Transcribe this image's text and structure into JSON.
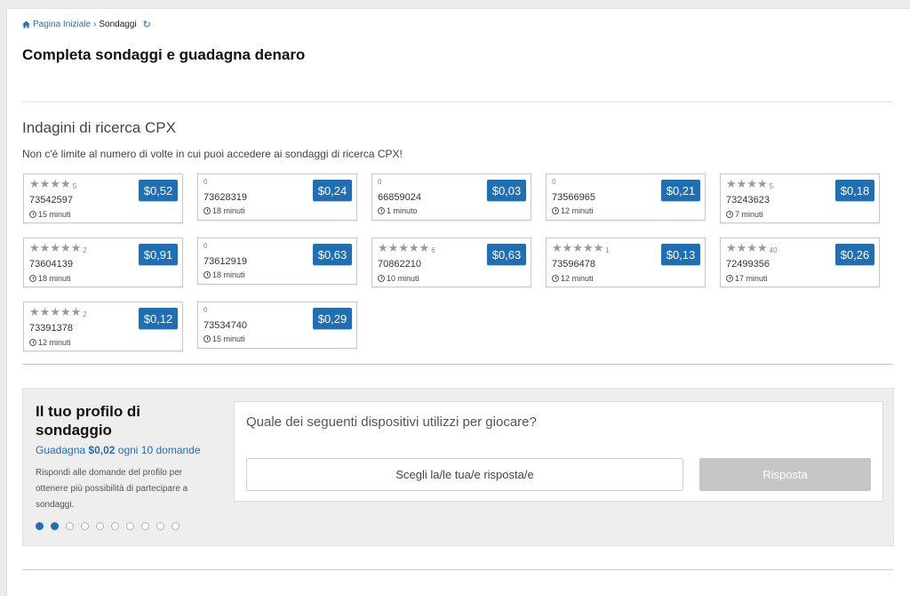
{
  "breadcrumb": {
    "home": "Pagina Iniziale",
    "separator": "›",
    "current": "Sondaggi",
    "home_icon": "home-icon",
    "refresh_icon": "refresh-icon"
  },
  "page_title": "Completa sondaggi e guadagna denaro",
  "cpx": {
    "title": "Indagini di ricerca CPX",
    "description": "Non c'è limite al numero di volte in cui puoi accedere ai sondaggi di ricerca CPX!",
    "star_color": "#9a9a9a",
    "price_color": "#1f6fb5",
    "surveys": [
      {
        "stars": 4,
        "ratings": "5",
        "id": "73542597",
        "duration": "15 minuti",
        "price": "$0,52"
      },
      {
        "stars": 0,
        "ratings": "0",
        "id": "73628319",
        "duration": "18 minuti",
        "price": "$0,24"
      },
      {
        "stars": 0,
        "ratings": "0",
        "id": "66859024",
        "duration": "1 minuto",
        "price": "$0,03"
      },
      {
        "stars": 0,
        "ratings": "0",
        "id": "73566965",
        "duration": "12 minuti",
        "price": "$0,21"
      },
      {
        "stars": 4,
        "ratings": "5",
        "id": "73243623",
        "duration": "7 minuti",
        "price": "$0,18"
      },
      {
        "stars": 5,
        "ratings": "2",
        "id": "73604139",
        "duration": "18 minuti",
        "price": "$0,91"
      },
      {
        "stars": 0,
        "ratings": "0",
        "id": "73612919",
        "duration": "18 minuti",
        "price": "$0,63"
      },
      {
        "stars": 5,
        "ratings": "6",
        "id": "70862210",
        "duration": "10 minuti",
        "price": "$0,63"
      },
      {
        "stars": 5,
        "ratings": "1",
        "id": "73596478",
        "duration": "12 minuti",
        "price": "$0,13"
      },
      {
        "stars": 4,
        "ratings": "40",
        "id": "72499356",
        "duration": "17 minuti",
        "price": "$0,26"
      },
      {
        "stars": 5,
        "ratings": "2",
        "id": "73391378",
        "duration": "12 minuti",
        "price": "$0,12"
      },
      {
        "stars": 0,
        "ratings": "0",
        "id": "73534740",
        "duration": "15 minuti",
        "price": "$0,29"
      }
    ]
  },
  "profile": {
    "title": "Il tuo profilo di sondaggio",
    "earn_prefix": "Guadagna",
    "earn_amount": "$0,02",
    "earn_suffix": "ogni 10 domande",
    "note": "Rispondi alle domande del profilo per ottenere più possibilità di partecipare a sondaggi.",
    "progress": {
      "total": 10,
      "completed": 2
    },
    "question": "Quale dei seguenti dispositivi utilizzi per giocare?",
    "choose_label": "Scegli la/le tua/e risposta/e",
    "answer_label": "Risposta"
  }
}
